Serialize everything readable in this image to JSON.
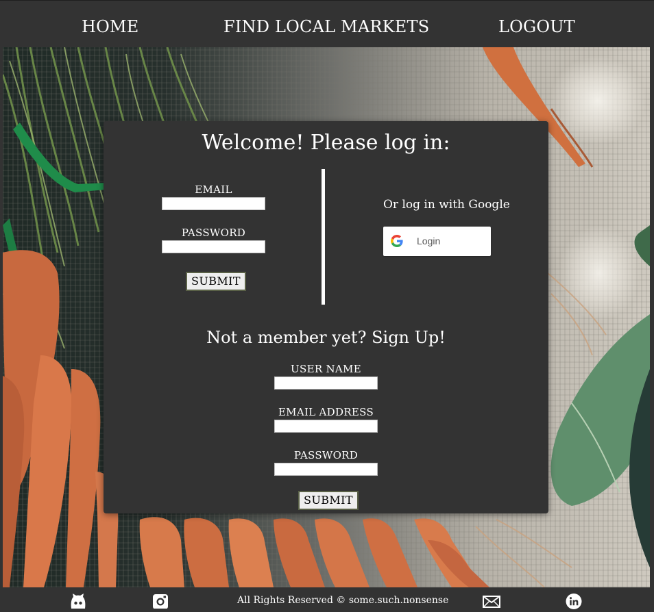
{
  "nav": {
    "home": "HOME",
    "markets": "FIND LOCAL MARKETS",
    "logout": "LOGOUT"
  },
  "login": {
    "title": "Welcome! Please log in:",
    "email_label": "EMAIL",
    "email_value": "",
    "password_label": "PASSWORD",
    "password_value": "",
    "submit_label": "SUBMIT"
  },
  "google": {
    "prompt": "Or log in with Google",
    "button_label": "Login",
    "icon": "google-g-logo"
  },
  "signup": {
    "title": "Not a member yet? Sign Up!",
    "username_label": "USER NAME",
    "username_value": "",
    "email_label": "EMAIL ADDRESS",
    "email_value": "",
    "password_label": "PASSWORD",
    "password_value": "",
    "submit_label": "SUBMIT"
  },
  "footer": {
    "copyright": "All Rights Reserved © some.such.nonsense",
    "icons": [
      "github-icon",
      "instagram-icon",
      "mail-icon",
      "linkedin-icon"
    ]
  },
  "colors": {
    "panel": "#333333",
    "text": "#ffffff",
    "button_bg": "#eeeeee",
    "button_border": "#5a6147"
  }
}
